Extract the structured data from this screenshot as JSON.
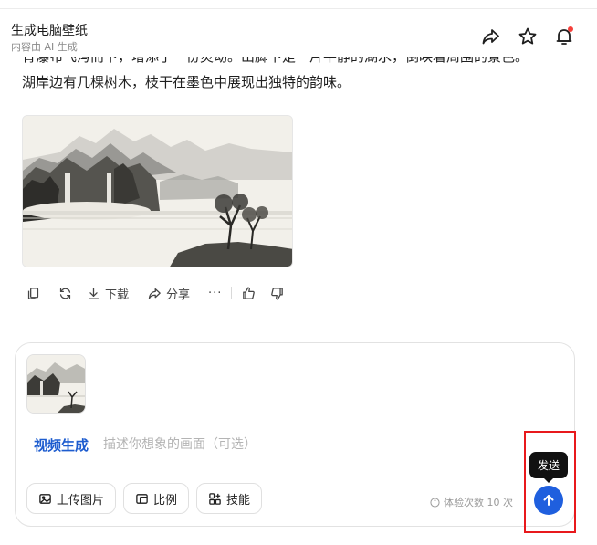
{
  "header": {
    "title": "生成电脑壁纸",
    "subtitle": "内容由 AI 生成",
    "icons": [
      "share-icon",
      "star-icon",
      "bell-icon"
    ],
    "notification_dot_color": "#f5403b"
  },
  "message": {
    "line_partial": "青瀑布飞泻而下，增添了一份灵动。山脚下是一片平静的湖水，倒映着周围的景色。",
    "line_last": "湖岸边有几棵树木，枝干在墨色中展现出独特的韵味。"
  },
  "actions": {
    "download_label": "下载",
    "share_label": "分享",
    "more_label": "···"
  },
  "composer": {
    "mode_label": "视频生成",
    "prompt_placeholder": "描述你想象的画面（可选）",
    "prompt_value": "",
    "upload_label": "上传图片",
    "ratio_label": "比例",
    "skills_label": "技能",
    "quota_text": "体验次数 10 次"
  },
  "send": {
    "tooltip": "发送",
    "color": "#1f5fde"
  },
  "colors": {
    "accent": "#1d5ccf",
    "highlight": "#e8191c"
  }
}
